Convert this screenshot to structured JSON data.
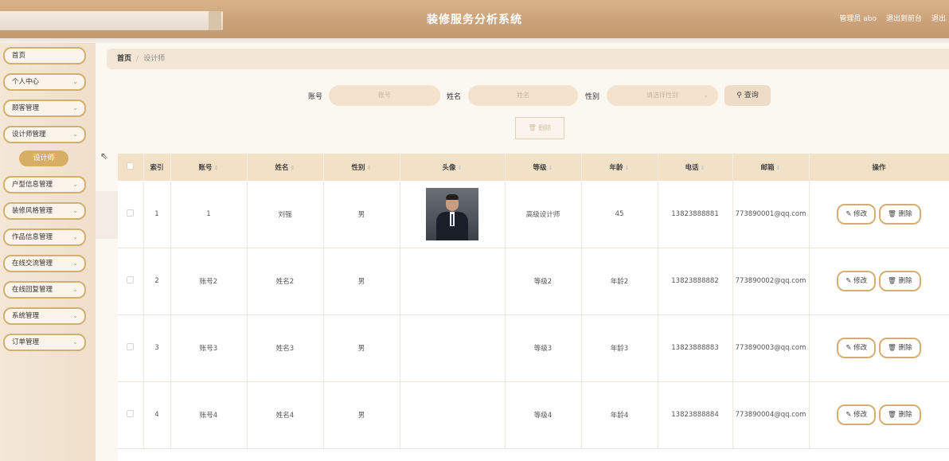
{
  "header": {
    "title": "装修服务分析系统",
    "user_text": "管理员 abo",
    "front_link": "退出到前台",
    "logout": "退出"
  },
  "sidebar": {
    "items": [
      {
        "label": "首页",
        "has_chevron": false
      },
      {
        "label": "个人中心",
        "has_chevron": true
      },
      {
        "label": "顾客管理",
        "has_chevron": true
      },
      {
        "label": "设计师管理",
        "has_chevron": true
      },
      {
        "label": "户型信息管理",
        "has_chevron": true
      },
      {
        "label": "装修风格管理",
        "has_chevron": true
      },
      {
        "label": "作品信息管理",
        "has_chevron": true
      },
      {
        "label": "在线交流管理",
        "has_chevron": true
      },
      {
        "label": "在线回复管理",
        "has_chevron": true
      },
      {
        "label": "系统管理",
        "has_chevron": true
      },
      {
        "label": "订单管理",
        "has_chevron": true
      }
    ],
    "active_sub": "设计师"
  },
  "breadcrumb": {
    "home": "首页",
    "separator": "/",
    "current": "设计师"
  },
  "search": {
    "account_label": "账号",
    "account_placeholder": "账号",
    "name_label": "姓名",
    "name_placeholder": "姓名",
    "gender_label": "性别",
    "gender_placeholder": "请选择性别",
    "query_button": "查询"
  },
  "delete_button": "删除",
  "table": {
    "columns": [
      "索引",
      "账号",
      "姓名",
      "性别",
      "头像",
      "等级",
      "年龄",
      "电话",
      "邮箱",
      "操作"
    ],
    "rows": [
      {
        "index": "1",
        "account": "1",
        "name": "刘强",
        "gender": "男",
        "avatar": true,
        "level": "高级设计师",
        "age": "45",
        "phone": "13823888881",
        "email": "773890001@qq.com"
      },
      {
        "index": "2",
        "account": "账号2",
        "name": "姓名2",
        "gender": "男",
        "avatar": false,
        "level": "等级2",
        "age": "年龄2",
        "phone": "13823888882",
        "email": "773890002@qq.com"
      },
      {
        "index": "3",
        "account": "账号3",
        "name": "姓名3",
        "gender": "男",
        "avatar": false,
        "level": "等级3",
        "age": "年龄3",
        "phone": "13823888883",
        "email": "773890003@qq.com"
      },
      {
        "index": "4",
        "account": "账号4",
        "name": "姓名4",
        "gender": "男",
        "avatar": false,
        "level": "等级4",
        "age": "年龄4",
        "phone": "13823888884",
        "email": "773890004@qq.com"
      }
    ],
    "edit_label": "修改",
    "delete_label": "删除"
  },
  "colors": {
    "accent": "#d4b070",
    "header": "#c9a074",
    "table_header": "#f3e1c7"
  }
}
